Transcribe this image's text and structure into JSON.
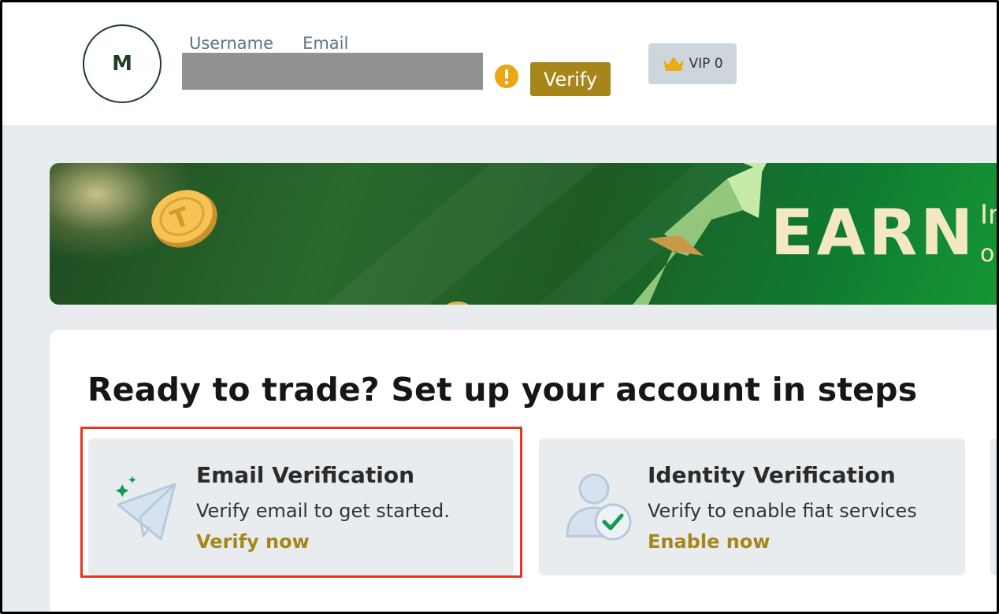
{
  "header": {
    "avatar_initial": "M",
    "tabs": [
      "Username",
      "Email"
    ],
    "verify_label": "Verify",
    "vip_label": "VIP 0"
  },
  "banner": {
    "headline": "EARN",
    "side_text_1": "In",
    "side_text_2": "o"
  },
  "setup": {
    "title": "Ready to trade? Set up your account in steps",
    "steps": [
      {
        "title": "Email Verification",
        "description": "Verify email to get started.",
        "action": "Verify now"
      },
      {
        "title": "Identity Verification",
        "description": "Verify to enable fiat services",
        "action": "Enable now"
      }
    ]
  },
  "colors": {
    "accent_gold": "#a6861a",
    "highlight_red": "#e8341f",
    "avatar_green": "#1f3d26",
    "warning_yellow": "#e9a713"
  }
}
